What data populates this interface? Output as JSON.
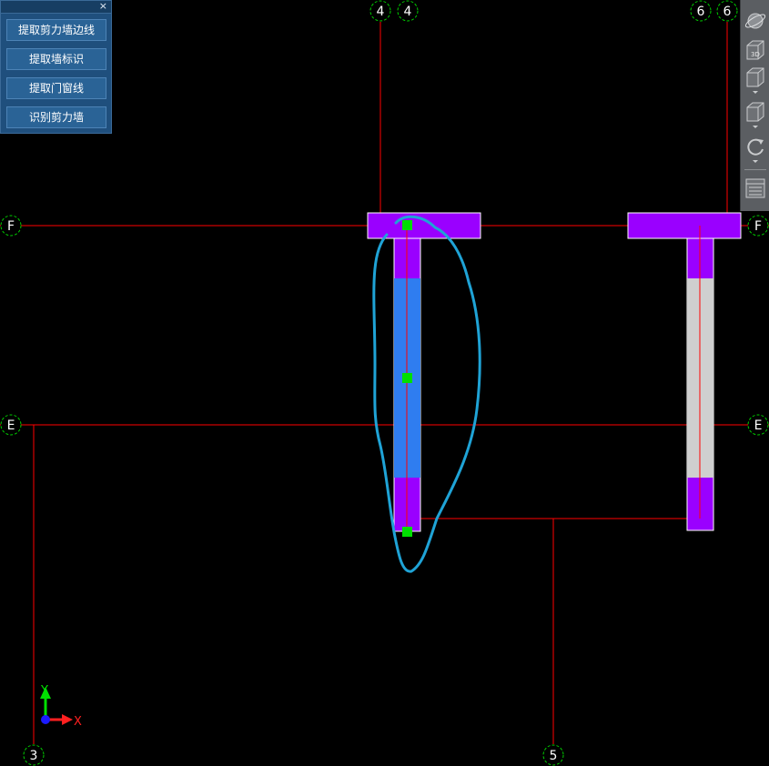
{
  "panel": {
    "close_glyph": "×",
    "buttons": [
      {
        "label": "提取剪力墙边线"
      },
      {
        "label": "提取墙标识"
      },
      {
        "label": "提取门窗线"
      },
      {
        "label": "识别剪力墙"
      }
    ]
  },
  "toolbar": {
    "items": [
      {
        "icon": "orbit-icon"
      },
      {
        "icon": "view-3d-icon",
        "label": "3D"
      },
      {
        "icon": "view-cube-dropdown-icon"
      },
      {
        "icon": "box-dropdown-icon"
      },
      {
        "icon": "rotate-dropdown-icon"
      },
      {
        "icon": "layer-list-icon"
      }
    ]
  },
  "axes": {
    "top": [
      "4",
      "4",
      "6",
      "6"
    ],
    "left": [
      "F",
      "E"
    ],
    "right": [
      "F",
      "E"
    ],
    "bottom": [
      "3",
      "5"
    ]
  },
  "ucs": {
    "x_label": "X",
    "y_label": "Y"
  },
  "colors": {
    "background": "#000000",
    "axis_line": "#ff0000",
    "bubble": "#00cc00",
    "wall_end": "#9a00ff",
    "wall_selected": "#2f7df0",
    "wall_unselected": "#cfcfcf",
    "grip": "#00e000",
    "sketch": "#1fa3d6"
  }
}
